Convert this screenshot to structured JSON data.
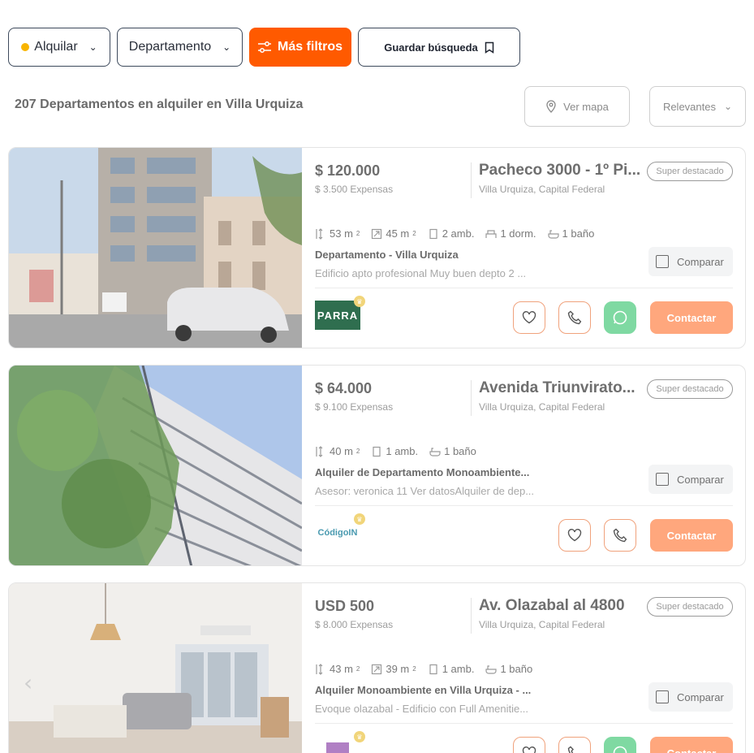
{
  "filters": {
    "operation": "Alquilar",
    "property_type": "Departamento",
    "more_filters": "Más filtros",
    "save_search": "Guardar búsqueda"
  },
  "results": {
    "title": "207 Departamentos en alquiler en Villa Urquiza",
    "map_button": "Ver mapa",
    "sort": "Relevantes"
  },
  "colors": {
    "accent": "#ff5a00",
    "contact": "#ffa77d",
    "whatsapp": "#7fd9a2",
    "dot": "#f8b400"
  },
  "listings": [
    {
      "price": "$ 120.000",
      "expenses": "$ 3.500 Expensas",
      "address": "Pacheco 3000 - 1º Pi...",
      "location": "Villa Urquiza, Capital Federal",
      "badge": "Super destacado",
      "features": [
        {
          "icon": "total-area-icon",
          "value": "53 m",
          "sup": "2"
        },
        {
          "icon": "covered-area-icon",
          "value": "45 m",
          "sup": "2"
        },
        {
          "icon": "door-icon",
          "value": "2 amb.",
          "sup": ""
        },
        {
          "icon": "bed-icon",
          "value": "1 dorm.",
          "sup": ""
        },
        {
          "icon": "bath-icon",
          "value": "1 baño",
          "sup": ""
        }
      ],
      "headline": "Departamento - Villa Urquiza",
      "description": "Edificio apto profesional Muy buen depto 2 ...",
      "compare": "Comparar",
      "publisher_logo": "PARRA",
      "contact": "Contactar",
      "whatsapp": true
    },
    {
      "price": "$ 64.000",
      "expenses": "$ 9.100 Expensas",
      "address": "Avenida Triunvirato...",
      "location": "Villa Urquiza, Capital Federal",
      "badge": "Super destacado",
      "features": [
        {
          "icon": "total-area-icon",
          "value": "40 m",
          "sup": "2"
        },
        {
          "icon": "door-icon",
          "value": "1 amb.",
          "sup": ""
        },
        {
          "icon": "bath-icon",
          "value": "1 baño",
          "sup": ""
        }
      ],
      "headline": "Alquiler de Departamento Monoambiente...",
      "description": "Asesor: veronica 11 Ver datosAlquiler de dep...",
      "compare": "Comparar",
      "publisher_logo": "CódigoIN",
      "contact": "Contactar",
      "whatsapp": false
    },
    {
      "price": "USD 500",
      "expenses": "$ 8.000 Expensas",
      "address": "Av. Olazabal al 4800",
      "location": "Villa Urquiza, Capital Federal",
      "badge": "Super destacado",
      "features": [
        {
          "icon": "total-area-icon",
          "value": "43 m",
          "sup": "2"
        },
        {
          "icon": "covered-area-icon",
          "value": "39 m",
          "sup": "2"
        },
        {
          "icon": "door-icon",
          "value": "1 amb.",
          "sup": ""
        },
        {
          "icon": "bath-icon",
          "value": "1 baño",
          "sup": ""
        }
      ],
      "headline": "Alquiler Monoambiente en Villa Urquiza - ...",
      "description": "Evoque olazabal - Edificio con Full Amenitie...",
      "compare": "Comparar",
      "publisher_logo": "",
      "contact": "Contactar",
      "whatsapp": true
    }
  ]
}
